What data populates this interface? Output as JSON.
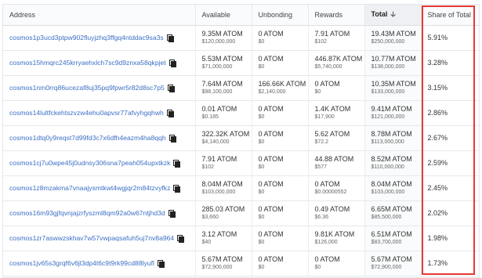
{
  "table": {
    "headers": {
      "address": "Address",
      "available": "Available",
      "unbonding": "Unbonding",
      "rewards": "Rewards",
      "total": "Total",
      "share": "Share of Total"
    },
    "sort_icon": "arrow-down-icon",
    "rows": [
      {
        "address": "cosmos1p3ucd3ptpw902fluyjzhq3ffgq4ntddac9sa3s",
        "available": "9.35M ATOM",
        "available_usd": "$120,000,000",
        "unbonding": "0 ATOM",
        "unbonding_usd": "$0",
        "rewards": "7.91 ATOM",
        "rewards_usd": "$102",
        "total": "19.43M ATOM",
        "total_usd": "$250,000,000",
        "share": "5.91%"
      },
      {
        "address": "cosmos15hmqrc245krryaehxlch7sc9d9znxa58qkpjet",
        "available": "5.53M ATOM",
        "available_usd": "$71,000,000",
        "unbonding": "0 ATOM",
        "unbonding_usd": "$0",
        "rewards": "446.87K ATOM",
        "rewards_usd": "$5,740,000",
        "total": "10.77M ATOM",
        "total_usd": "$138,000,000",
        "share": "3.28%"
      },
      {
        "address": "cosmos1nm0rrq86ucezaf8uj35pq9fpwr5r82d8sc7p5",
        "available": "7.64M ATOM",
        "available_usd": "$98,100,000",
        "unbonding": "166.66K ATOM",
        "unbonding_usd": "$2,140,000",
        "rewards": "0 ATOM",
        "rewards_usd": "$0",
        "total": "10.35M ATOM",
        "total_usd": "$133,000,000",
        "share": "3.15%"
      },
      {
        "address": "cosmos14lultfckehtszvzw4ehu0apvsr77afvyhgqhwh",
        "available": "0.01 ATOM",
        "available_usd": "$0.185",
        "unbonding": "0 ATOM",
        "unbonding_usd": "$0",
        "rewards": "1.4K ATOM",
        "rewards_usd": "$17,900",
        "total": "9.41M ATOM",
        "total_usd": "$121,000,000",
        "share": "2.86%"
      },
      {
        "address": "cosmos1dtq0y9reqst7d99fd3c7x6dfh4eazm4ha8qqh",
        "available": "322.32K ATOM",
        "available_usd": "$4,140,000",
        "unbonding": "0 ATOM",
        "unbonding_usd": "$0",
        "rewards": "5.62 ATOM",
        "rewards_usd": "$72.2",
        "total": "8.78M ATOM",
        "total_usd": "$113,000,000",
        "share": "2.67%"
      },
      {
        "address": "cosmos1cj7u0wpe45j0udnsy306sna7peah054upxtkzk",
        "available": "7.91 ATOM",
        "available_usd": "$102",
        "unbonding": "0 ATOM",
        "unbonding_usd": "$0",
        "rewards": "44.88 ATOM",
        "rewards_usd": "$577",
        "total": "8.52M ATOM",
        "total_usd": "$110,000,000",
        "share": "2.59%"
      },
      {
        "address": "cosmos1z8mzakma7vnaajysmtkwt4wgjqr2m84tzvyfkz",
        "available": "8.04M ATOM",
        "available_usd": "$103,000,000",
        "unbonding": "0 ATOM",
        "unbonding_usd": "$0",
        "rewards": "0 ATOM",
        "rewards_usd": "$0.00000552",
        "total": "8.04M ATOM",
        "total_usd": "$103,000,000",
        "share": "2.45%"
      },
      {
        "address": "cosmos16m93gjfqvnjajzrfyszml8qm92a0w67ntjhd3d",
        "available": "285.03 ATOM",
        "available_usd": "$3,660",
        "unbonding": "0 ATOM",
        "unbonding_usd": "$0",
        "rewards": "0.49 ATOM",
        "rewards_usd": "$6.36",
        "total": "6.65M ATOM",
        "total_usd": "$85,500,000",
        "share": "2.02%"
      },
      {
        "address": "cosmos1zr7aswwzskhav7w57vwpaqsafuh5uj7nv8a964",
        "available": "3.12 ATOM",
        "available_usd": "$40",
        "unbonding": "0 ATOM",
        "unbonding_usd": "$0",
        "rewards": "9.81K ATOM",
        "rewards_usd": "$126,000",
        "total": "6.51M ATOM",
        "total_usd": "$83,700,000",
        "share": "1.98%"
      },
      {
        "address": "cosmos1jv65s3grqf6v6jl3dp4t6c9t9rk99cd88lyufl",
        "available": "5.67M ATOM",
        "available_usd": "$72,900,000",
        "unbonding": "0 ATOM",
        "unbonding_usd": "$0",
        "rewards": "0 ATOM",
        "rewards_usd": "$0",
        "total": "5.67M ATOM",
        "total_usd": "$72,900,000",
        "share": "1.73%"
      }
    ]
  },
  "colors": {
    "address_link": "#3b6fc4",
    "highlight_border": "#e53935",
    "sorted_header_bg": "#eef0f3"
  },
  "icons": {
    "copy": "copy-icon",
    "sort": "arrow-down-icon"
  }
}
